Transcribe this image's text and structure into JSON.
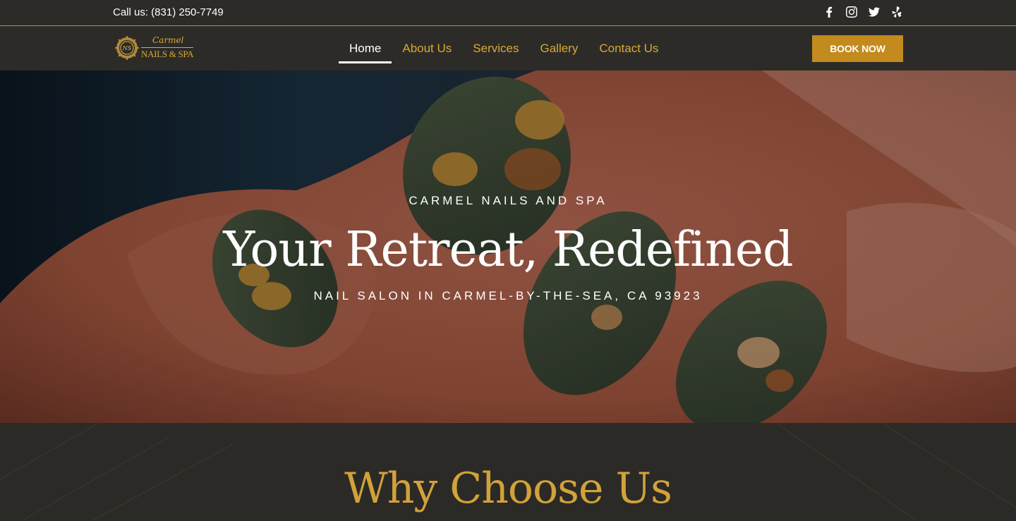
{
  "topbar": {
    "phone": "Call us: (831) 250-7749",
    "social_icons": [
      "facebook-icon",
      "instagram-icon",
      "twitter-icon",
      "yelp-icon"
    ]
  },
  "nav": {
    "logo_line1": "Carmel",
    "logo_line2": "NAILS & SPA",
    "items": [
      {
        "label": "Home",
        "active": true
      },
      {
        "label": "About Us",
        "active": false
      },
      {
        "label": "Services",
        "active": false
      },
      {
        "label": "Gallery",
        "active": false
      },
      {
        "label": "Contact Us",
        "active": false
      }
    ],
    "book_label": "BOOK NOW"
  },
  "hero": {
    "eyebrow": "CARMEL NAILS AND SPA",
    "title": "Your Retreat, Redefined",
    "subtitle": "NAIL SALON IN CARMEL-BY-THE-SEA, CA 93923"
  },
  "why": {
    "title": "Why Choose Us"
  },
  "colors": {
    "gold": "#d9a938",
    "button": "#c38a1d",
    "background": "#2b2a26"
  }
}
